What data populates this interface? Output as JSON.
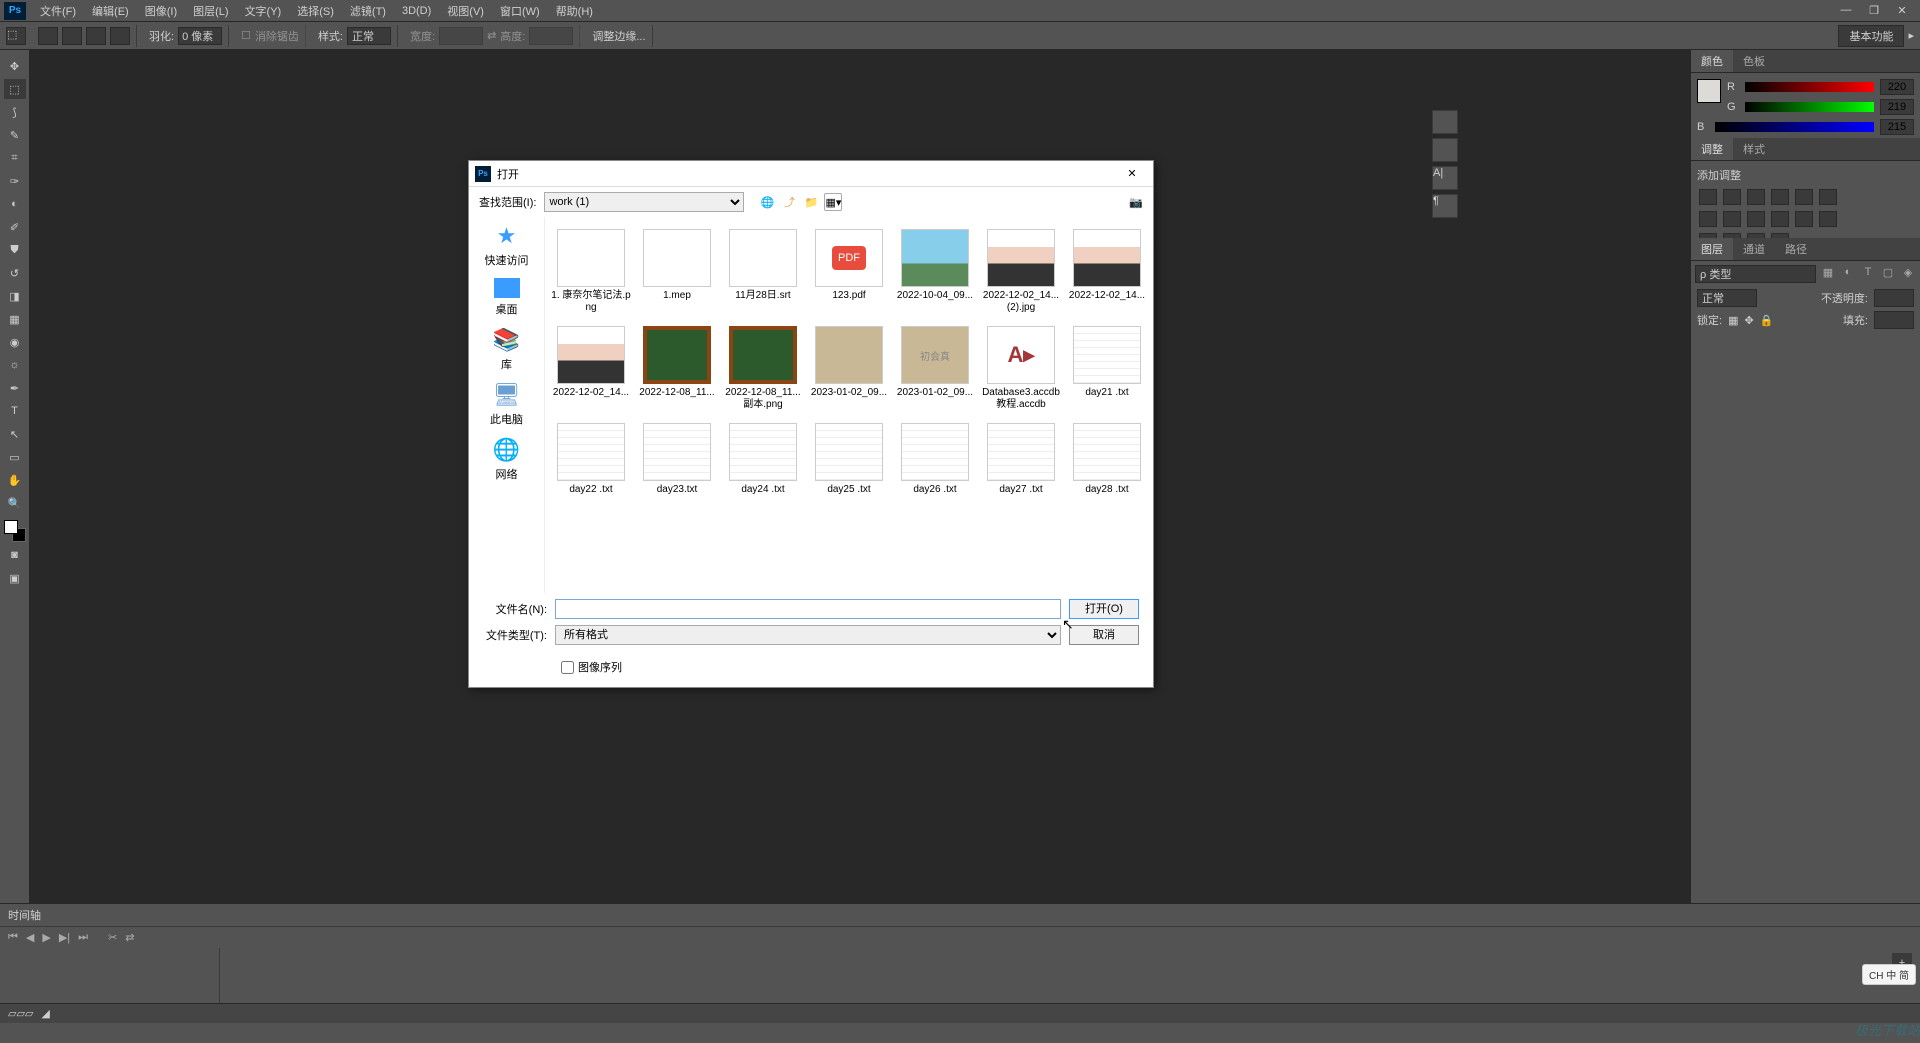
{
  "menubar": {
    "items": [
      "文件(F)",
      "编辑(E)",
      "图像(I)",
      "图层(L)",
      "文字(Y)",
      "选择(S)",
      "滤镜(T)",
      "3D(D)",
      "视图(V)",
      "窗口(W)",
      "帮助(H)"
    ]
  },
  "options": {
    "feather_label": "羽化:",
    "feather_value": "0 像素",
    "antialias": "消除锯齿",
    "style_label": "样式:",
    "style_value": "正常",
    "width_label": "宽度:",
    "height_label": "高度:",
    "refine_edge": "调整边缘...",
    "basic_fn": "基本功能"
  },
  "color_panel": {
    "tabs": [
      "颜色",
      "色板"
    ],
    "r_label": "R",
    "r_value": "220",
    "g_label": "G",
    "g_value": "219",
    "b_label": "B",
    "b_value": "215"
  },
  "adjust_panel": {
    "tabs": [
      "调整",
      "样式"
    ],
    "add_label": "添加调整"
  },
  "layers_panel": {
    "tabs": [
      "图层",
      "通道",
      "路径"
    ],
    "kind": "ρ 类型",
    "blend": "正常",
    "opacity_label": "不透明度:",
    "lock_label": "锁定:",
    "fill_label": "填充:"
  },
  "timeline": {
    "title": "时间轴"
  },
  "dialog": {
    "title": "打开",
    "lookin_label": "查找范围(I):",
    "lookin_value": "work (1)",
    "sidebar": [
      {
        "icon": "star",
        "label": "快速访问"
      },
      {
        "icon": "desktop",
        "label": "桌面"
      },
      {
        "icon": "lib",
        "label": "库"
      },
      {
        "icon": "pc",
        "label": "此电脑"
      },
      {
        "icon": "net",
        "label": "网络"
      }
    ],
    "files": [
      {
        "name": "1. 康奈尔笔记法.png",
        "thumb": "doc"
      },
      {
        "name": "1.mep",
        "thumb": "blank"
      },
      {
        "name": "11月28日.srt",
        "thumb": "blank"
      },
      {
        "name": "123.pdf",
        "thumb": "pdf"
      },
      {
        "name": "2022-10-04_09...",
        "thumb": "img"
      },
      {
        "name": "2022-12-02_14... (2).jpg",
        "thumb": "portrait"
      },
      {
        "name": "2022-12-02_14...",
        "thumb": "portrait"
      },
      {
        "name": "2022-12-02_14...",
        "thumb": "portrait"
      },
      {
        "name": "2022-12-08_11...",
        "thumb": "chalkboard"
      },
      {
        "name": "2022-12-08_11...副本.png",
        "thumb": "chalkboard"
      },
      {
        "name": "2023-01-02_09...",
        "thumb": "tan"
      },
      {
        "name": "2023-01-02_09...",
        "thumb": "tan-text"
      },
      {
        "name": "Database3.accdb 教程.accdb",
        "thumb": "access"
      },
      {
        "name": "day21 .txt",
        "thumb": "txt"
      },
      {
        "name": "day22 .txt",
        "thumb": "txt"
      },
      {
        "name": "day23.txt",
        "thumb": "txt"
      },
      {
        "name": "day24 .txt",
        "thumb": "txt"
      },
      {
        "name": "day25 .txt",
        "thumb": "txt"
      },
      {
        "name": "day26 .txt",
        "thumb": "txt"
      },
      {
        "name": "day27 .txt",
        "thumb": "txt"
      },
      {
        "name": "day28 .txt",
        "thumb": "txt"
      }
    ],
    "filename_label": "文件名(N):",
    "filename_value": "",
    "filetype_label": "文件类型(T):",
    "filetype_value": "所有格式",
    "open_btn": "打开(O)",
    "cancel_btn": "取消",
    "image_sequence": "图像序列"
  },
  "ime": "CH 中 简",
  "statusbar": {
    "zoom": "",
    "doc": ""
  }
}
